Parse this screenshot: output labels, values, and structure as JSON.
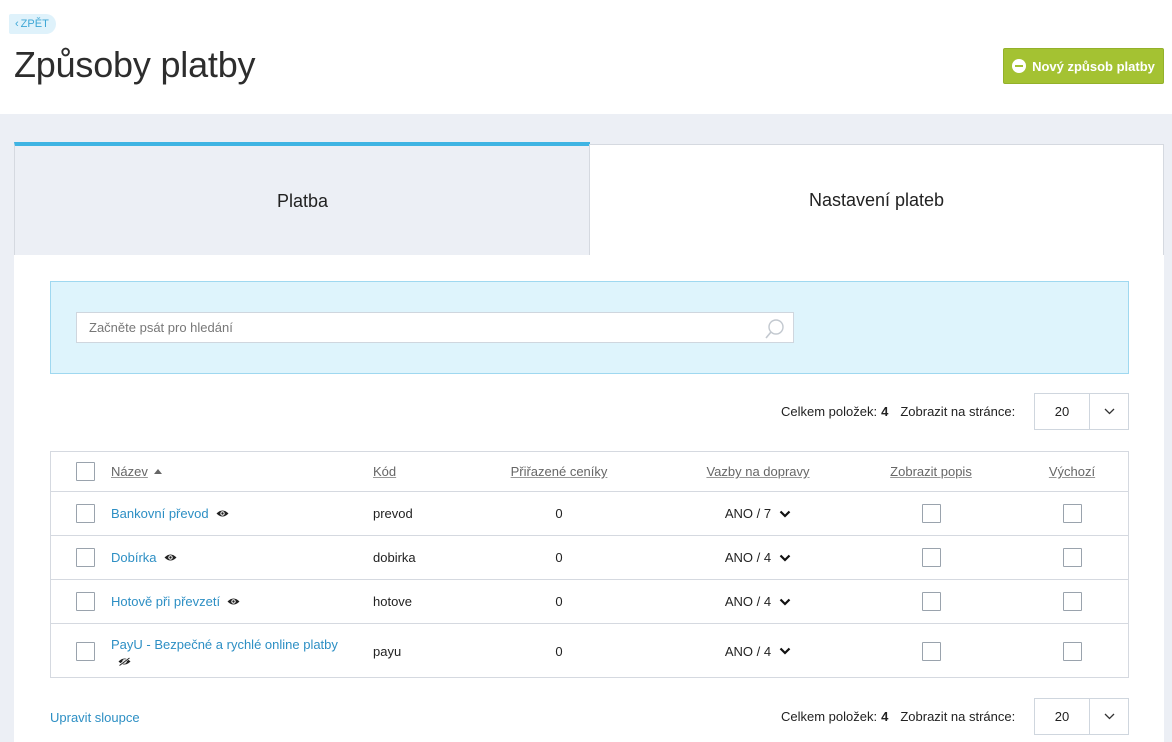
{
  "header": {
    "back_label": "ZPĚT",
    "title": "Způsoby platby",
    "new_button": "Nový způsob platby"
  },
  "tabs": [
    {
      "label": "Platba",
      "active": true
    },
    {
      "label": "Nastavení plateb",
      "active": false
    }
  ],
  "search": {
    "placeholder": "Začněte psát pro hledání"
  },
  "pager": {
    "total_label": "Celkem položek:",
    "total": "4",
    "per_page_label": "Zobrazit na stránce:",
    "per_page": "20"
  },
  "table": {
    "columns": [
      "Název",
      "Kód",
      "Přiřazené ceníky",
      "Vazby na dopravy",
      "Zobrazit popis",
      "Výchozí"
    ],
    "rows": [
      {
        "name": "Bankovní převod",
        "code": "prevod",
        "pricelists": "0",
        "shipping": "ANO / 7",
        "visible": true
      },
      {
        "name": "Dobírka",
        "code": "dobirka",
        "pricelists": "0",
        "shipping": "ANO / 4",
        "visible": true
      },
      {
        "name": "Hotově při převzetí",
        "code": "hotove",
        "pricelists": "0",
        "shipping": "ANO / 4",
        "visible": true
      },
      {
        "name": "PayU - Bezpečné a rychlé online platby",
        "code": "payu",
        "pricelists": "0",
        "shipping": "ANO / 4",
        "visible": false
      }
    ]
  },
  "footer": {
    "edit_columns": "Upravit sloupce"
  },
  "colors": {
    "accent_blue": "#3fb4e3",
    "link_blue": "#2d8fc4",
    "button_green": "#a4c232",
    "search_bg": "#def4fc"
  }
}
